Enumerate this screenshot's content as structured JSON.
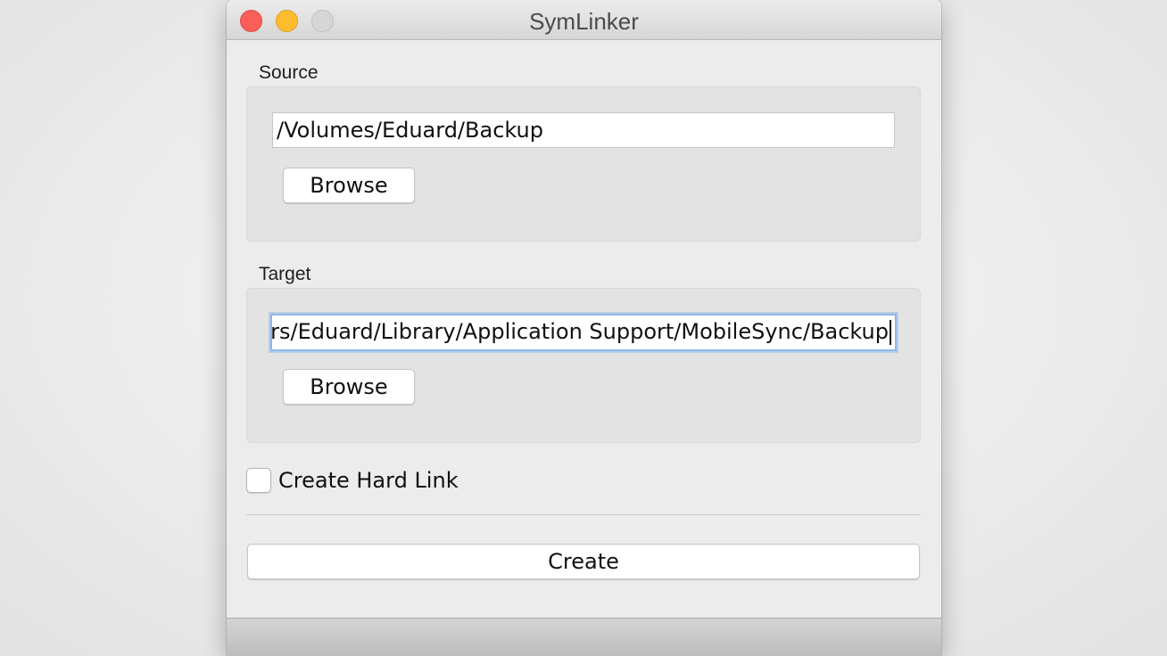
{
  "window": {
    "title": "SymLinker"
  },
  "source": {
    "label": "Source",
    "path": "/Volumes/Eduard/Backup",
    "browse_label": "Browse"
  },
  "target": {
    "label": "Target",
    "path": "/Users/Eduard/Library/Application Support/MobileSync/Backup",
    "browse_label": "Browse"
  },
  "hard_link": {
    "label": "Create Hard Link",
    "checked": false
  },
  "actions": {
    "create_label": "Create"
  },
  "colors": {
    "close": "#fc5f57",
    "minimize": "#fdbc2e",
    "zoom_inactive": "#d6d6d6",
    "focus_ring": "#8db7ea"
  }
}
